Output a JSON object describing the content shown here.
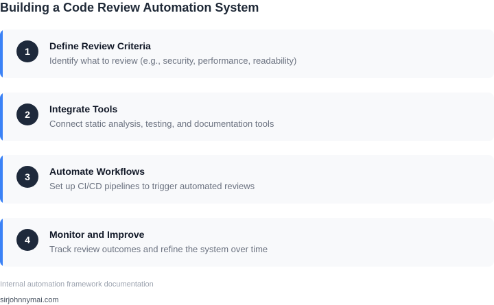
{
  "title": "Building a Code Review Automation System",
  "steps": [
    {
      "number": "1",
      "title": "Define Review Criteria",
      "description": "Identify what to review (e.g., security, performance, readability)"
    },
    {
      "number": "2",
      "title": "Integrate Tools",
      "description": "Connect static analysis, testing, and documentation tools"
    },
    {
      "number": "3",
      "title": "Automate Workflows",
      "description": "Set up CI/CD pipelines to trigger automated reviews"
    },
    {
      "number": "4",
      "title": "Monitor and Improve",
      "description": "Track review outcomes and refine the system over time"
    }
  ],
  "footer": {
    "note": "Internal automation framework documentation",
    "site": "sirjohnnymai.com"
  },
  "colors": {
    "accent": "#3b82f6",
    "badge": "#1e293b",
    "card_background": "#f8f9fb"
  }
}
